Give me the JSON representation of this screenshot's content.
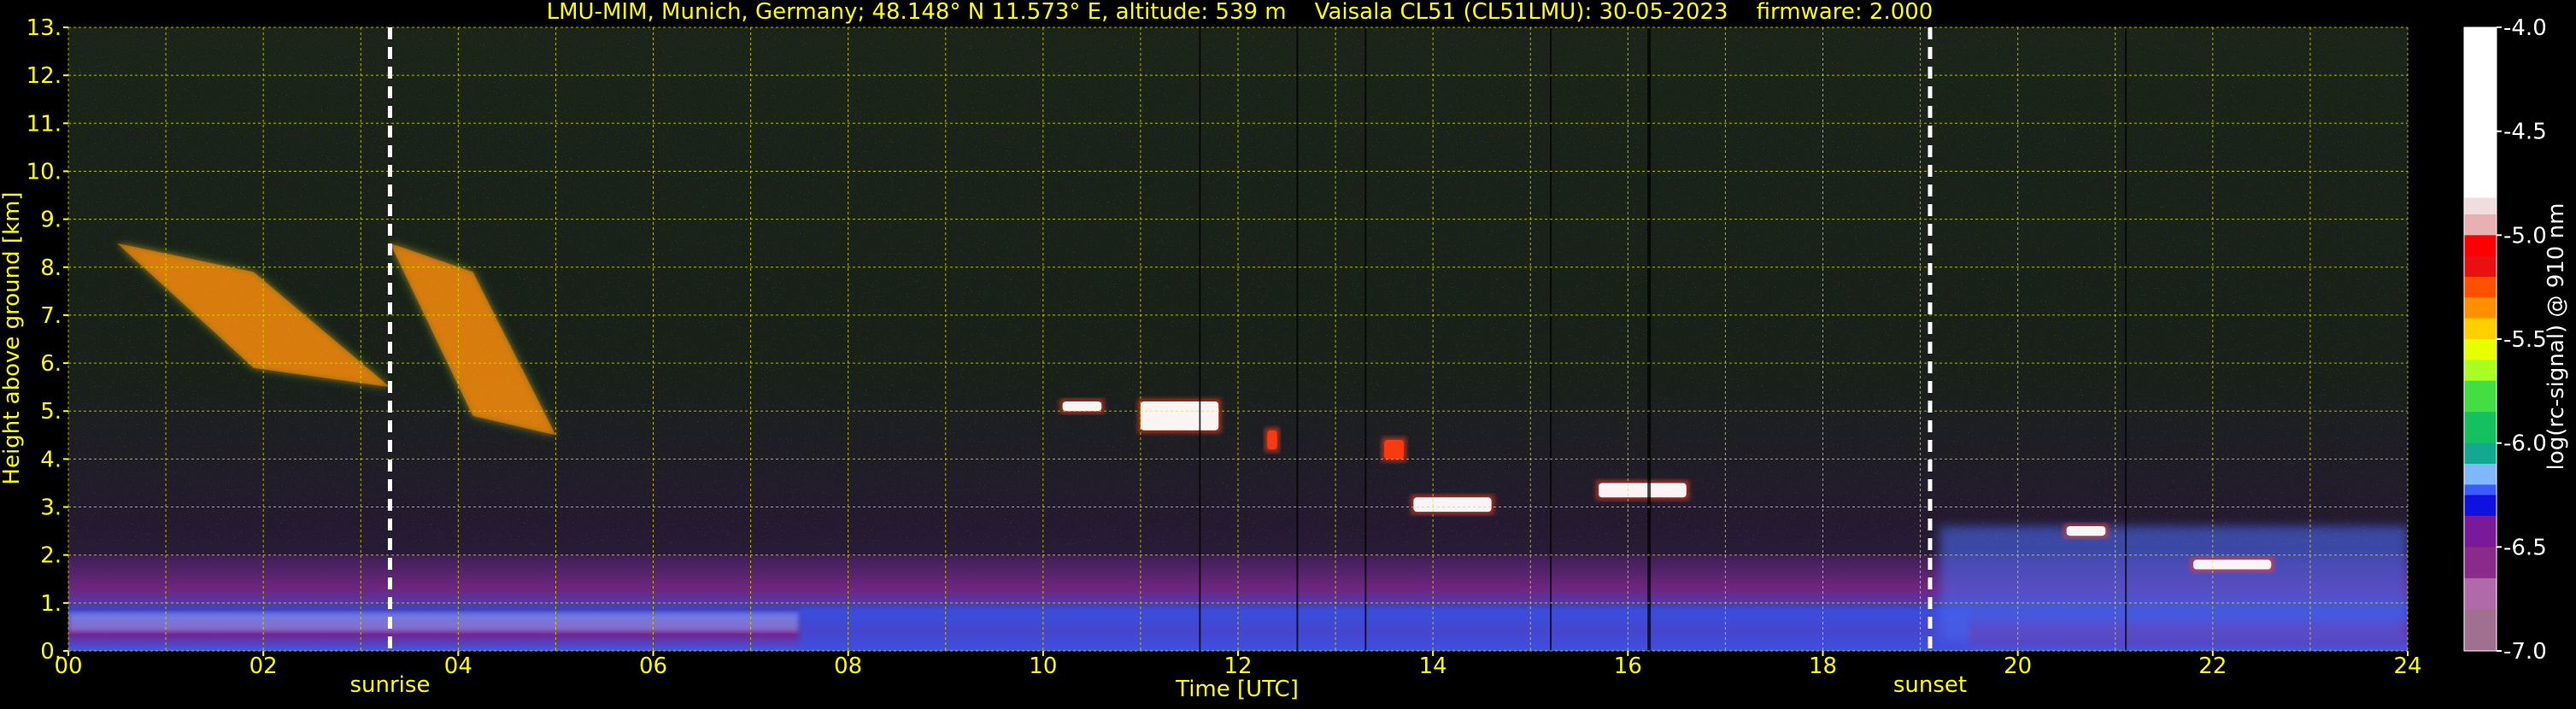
{
  "chart_data": {
    "type": "heatmap",
    "title": "LMU-MIM, Munich, Germany; 48.148° N 11.573° E, altitude: 539 m    Vaisala CL51 (CL51LMU): 30-05-2023    firmware: 2.000",
    "xlabel": "Time [UTC]",
    "ylabel": "Height above ground [km]",
    "colorbar_label": "log(rc-signal) @ 910 nm",
    "xlim": [
      0,
      24
    ],
    "ylim": [
      0,
      13
    ],
    "x_ticks": [
      "00",
      "02",
      "04",
      "06",
      "08",
      "10",
      "12",
      "14",
      "16",
      "18",
      "20",
      "22",
      "24"
    ],
    "x_tick_values": [
      0,
      2,
      4,
      6,
      8,
      10,
      12,
      14,
      16,
      18,
      20,
      22,
      24
    ],
    "y_ticks": [
      "0.",
      "1.",
      "2.",
      "3.",
      "4.",
      "5.",
      "6.",
      "7.",
      "8.",
      "9.",
      "10.",
      "11.",
      "12.",
      "13."
    ],
    "y_tick_values": [
      0,
      1,
      2,
      3,
      4,
      5,
      6,
      7,
      8,
      9,
      10,
      11,
      12,
      13
    ],
    "colorbar_ticks": [
      "-4.0",
      "-4.5",
      "-5.0",
      "-5.5",
      "-6.0",
      "-6.5",
      "-7.0"
    ],
    "colorbar_values": [
      -4.0,
      -4.5,
      -5.0,
      -5.5,
      -6.0,
      -6.5,
      -7.0
    ],
    "clim": [
      -7.0,
      -4.0
    ],
    "grid": true,
    "events": [
      {
        "label": "sunrise",
        "time": 3.3
      },
      {
        "label": "sunset",
        "time": 19.1
      }
    ],
    "features": [
      {
        "kind": "cirrus",
        "x": [
          0.5,
          3.3
        ],
        "y": [
          5.5,
          8.5
        ],
        "value": -5.0
      },
      {
        "kind": "cirrus",
        "x": [
          3.3,
          5.0
        ],
        "y": [
          4.5,
          8.5
        ],
        "value": -5.0
      },
      {
        "kind": "cloud",
        "x": [
          10.2,
          10.6
        ],
        "y": [
          5.0,
          5.2
        ],
        "value": -4.3
      },
      {
        "kind": "cloud",
        "x": [
          11.0,
          11.8
        ],
        "y": [
          4.6,
          5.2
        ],
        "value": -4.5
      },
      {
        "kind": "cloud",
        "x": [
          12.3,
          12.4
        ],
        "y": [
          4.2,
          4.6
        ],
        "value": -5.0
      },
      {
        "kind": "cloud",
        "x": [
          13.5,
          13.7
        ],
        "y": [
          4.0,
          4.4
        ],
        "value": -5.0
      },
      {
        "kind": "cloud",
        "x": [
          15.7,
          16.6
        ],
        "y": [
          3.2,
          3.5
        ],
        "value": -4.3
      },
      {
        "kind": "cloud",
        "x": [
          13.8,
          14.6
        ],
        "y": [
          2.9,
          3.2
        ],
        "value": -4.5
      },
      {
        "kind": "cloud",
        "x": [
          20.5,
          20.9
        ],
        "y": [
          2.4,
          2.6
        ],
        "value": -4.5
      },
      {
        "kind": "cloud",
        "x": [
          21.8,
          22.6
        ],
        "y": [
          1.7,
          1.9
        ],
        "value": -4.5
      },
      {
        "kind": "boundary_layer",
        "x": [
          0,
          24
        ],
        "y": [
          0,
          2.0
        ],
        "value": -6.2
      }
    ],
    "colors": {
      "background": "#000000",
      "text": "#ffff00",
      "grid": "#e5e500",
      "events": "#ffffff"
    }
  }
}
